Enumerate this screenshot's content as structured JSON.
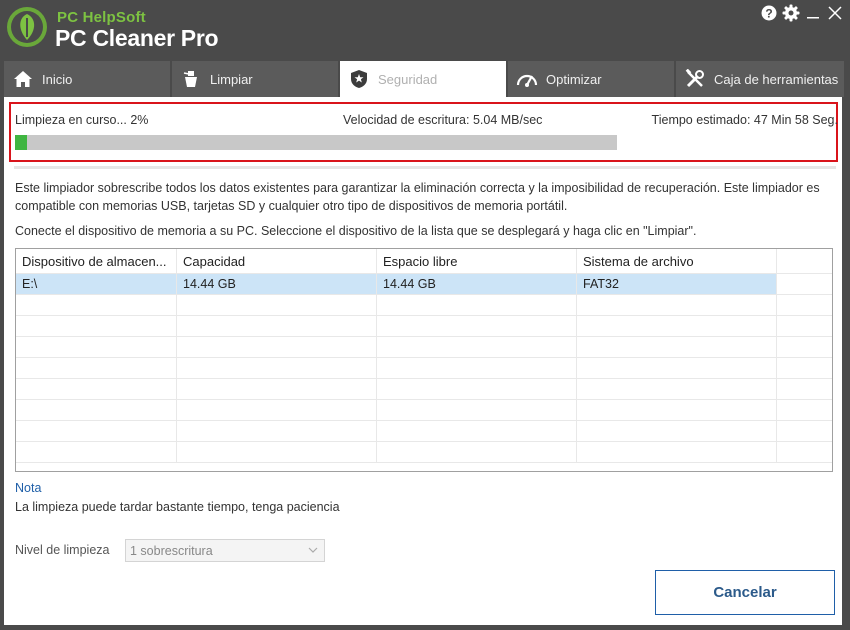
{
  "app": {
    "brand_small": "PC HelpSoft",
    "brand_big": "PC Cleaner Pro",
    "accent_green": "#7dc242"
  },
  "tabs": [
    {
      "label": "Inicio",
      "icon": "home-icon"
    },
    {
      "label": "Limpiar",
      "icon": "clean-icon"
    },
    {
      "label": "Seguridad",
      "icon": "shield-icon",
      "active": true
    },
    {
      "label": "Optimizar",
      "icon": "gauge-icon"
    },
    {
      "label": "Caja de herramientas",
      "icon": "tools-icon"
    }
  ],
  "progress": {
    "status": "Limpieza en curso... 2%",
    "speed": "Velocidad de escritura: 5.04 MB/sec",
    "eta": "Tiempo estimado: 47 Min 58 Seg.",
    "percent": 2,
    "fill_color": "#3fb541",
    "highlight_color": "#d9141b"
  },
  "description": {
    "p1": "Este limpiador sobrescribe todos los datos existentes para garantizar la eliminación correcta y la imposibilidad de recuperación. Este limpiador es compatible con memorias USB, tarjetas SD y cualquier otro tipo de dispositivos de memoria portátil.",
    "p2": "Conecte el dispositivo de memoria a su PC. Seleccione el dispositivo de la lista que se desplegará y haga clic en \"Limpiar\"."
  },
  "table": {
    "headers": [
      "Dispositivo de almacen...",
      "Capacidad",
      "Espacio libre",
      "Sistema de archivo"
    ],
    "rows": [
      [
        "E:\\",
        "14.44 GB",
        "14.44 GB",
        "FAT32"
      ]
    ]
  },
  "note": {
    "title": "Nota",
    "text": "La limpieza puede tardar bastante tiempo, tenga paciencia"
  },
  "level": {
    "label": "Nivel de limpieza",
    "selected": "1 sobrescritura"
  },
  "buttons": {
    "cancel": "Cancelar"
  }
}
